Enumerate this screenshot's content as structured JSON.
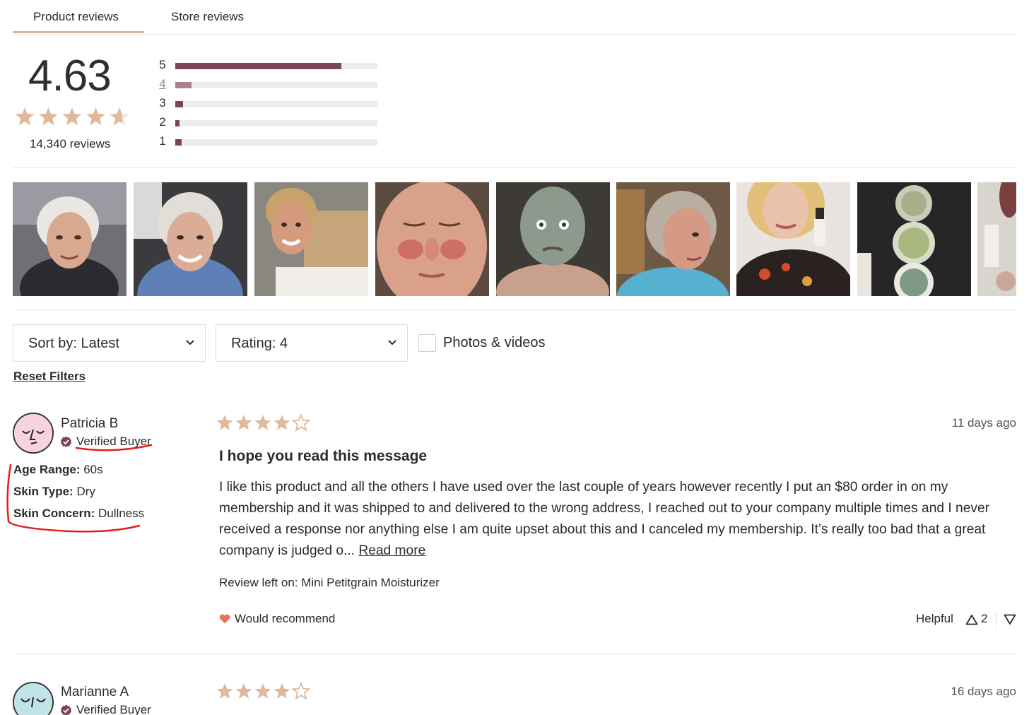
{
  "tabs": [
    {
      "label": "Product reviews",
      "active": true
    },
    {
      "label": "Store reviews",
      "active": false
    }
  ],
  "summary": {
    "average": "4.63",
    "average_rating_value": 4.63,
    "review_count": "14,340 reviews",
    "distribution": [
      {
        "label": "5",
        "fill_fraction": 0.82,
        "linked": false
      },
      {
        "label": "4",
        "fill_fraction": 0.08,
        "linked": true
      },
      {
        "label": "3",
        "fill_fraction": 0.04,
        "linked": false
      },
      {
        "label": "2",
        "fill_fraction": 0.02,
        "linked": false
      },
      {
        "label": "1",
        "fill_fraction": 0.03,
        "linked": false
      }
    ]
  },
  "photos": [
    {
      "name": "photo-1"
    },
    {
      "name": "photo-2"
    },
    {
      "name": "photo-3"
    },
    {
      "name": "photo-4"
    },
    {
      "name": "photo-5"
    },
    {
      "name": "photo-6"
    },
    {
      "name": "photo-7"
    },
    {
      "name": "photo-8"
    },
    {
      "name": "photo-9"
    }
  ],
  "filters": {
    "sort_label": "Sort by: Latest",
    "rating_label": "Rating: 4",
    "photos_videos_label": "Photos & videos",
    "photos_videos_checked": false,
    "reset_label": "Reset Filters"
  },
  "reviews": [
    {
      "author": "Patricia B",
      "verified_label": "Verified Buyer",
      "attributes": [
        {
          "key": "Age Range:",
          "value": "60s"
        },
        {
          "key": "Skin Type:",
          "value": "Dry"
        },
        {
          "key": "Skin Concern:",
          "value": "Dullness"
        }
      ],
      "rating": 4,
      "date": "11 days ago",
      "title": "I hope you read this message",
      "body": "I like this product and all the others I have used over the last couple of years however recently I put an $80 order in on my membership and it was shipped to and delivered to the wrong address, I reached out to your company multiple times and I never received a response nor anything else I am quite upset about this and I canceled my membership. It’s really too bad that a great company is judged o...",
      "read_more": "Read more",
      "product_line": "Review left on: Mini Petitgrain Moisturizer",
      "recommend": "Would recommend",
      "helpful_label": "Helpful",
      "helpful_up": "2",
      "avatar_color": "#f6d3dd"
    },
    {
      "author": "Marianne A",
      "verified_label": "Verified Buyer",
      "rating": 4,
      "date": "16 days ago",
      "avatar_color": "#bfe3e6"
    }
  ],
  "colors": {
    "star": "#e0b89c",
    "bar_dark": "#7d4358",
    "bar_light": "#a9808f",
    "heart": "#e8735a",
    "annotation": "#e0201c"
  },
  "icons": [
    "star-icon",
    "chevron-down-icon",
    "verified-badge-icon",
    "heart-icon",
    "thumbs-up-triangle-icon",
    "thumbs-down-triangle-icon",
    "avatar-face-icon"
  ]
}
